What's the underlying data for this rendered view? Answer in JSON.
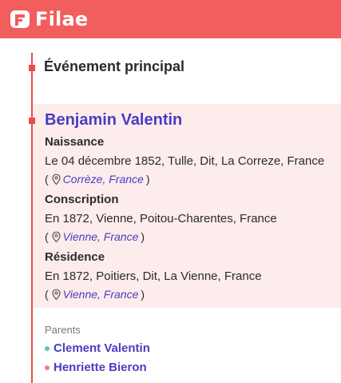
{
  "header": {
    "brand": "Filae",
    "colors": {
      "bar": "#f25d5d",
      "accent": "#4b3cc0"
    }
  },
  "section": {
    "title": "Événement principal"
  },
  "person": {
    "name": "Benjamin Valentin",
    "events": [
      {
        "label": "Naissance",
        "text": "Le 04 décembre 1852, Tulle, Dit, La Correze, France",
        "location": "Corrèze, France"
      },
      {
        "label": "Conscription",
        "text": "En 1872, Vienne, Poitou-Charentes, France",
        "location": "Vienne, France"
      },
      {
        "label": "Résidence",
        "text": "En 1872, Poitiers, Dit, La Vienne, France",
        "location": "Vienne, France"
      }
    ]
  },
  "parents": {
    "label": "Parents",
    "items": [
      {
        "name": "Clement Valentin",
        "dot_color": "#5bc4c0"
      },
      {
        "name": "Henriette Bieron",
        "dot_color": "#f07f8a"
      }
    ]
  },
  "icons": {
    "logo": "filae-logo-icon",
    "pin": "map-pin-icon"
  },
  "punct": {
    "open": "(",
    "close": ")"
  }
}
